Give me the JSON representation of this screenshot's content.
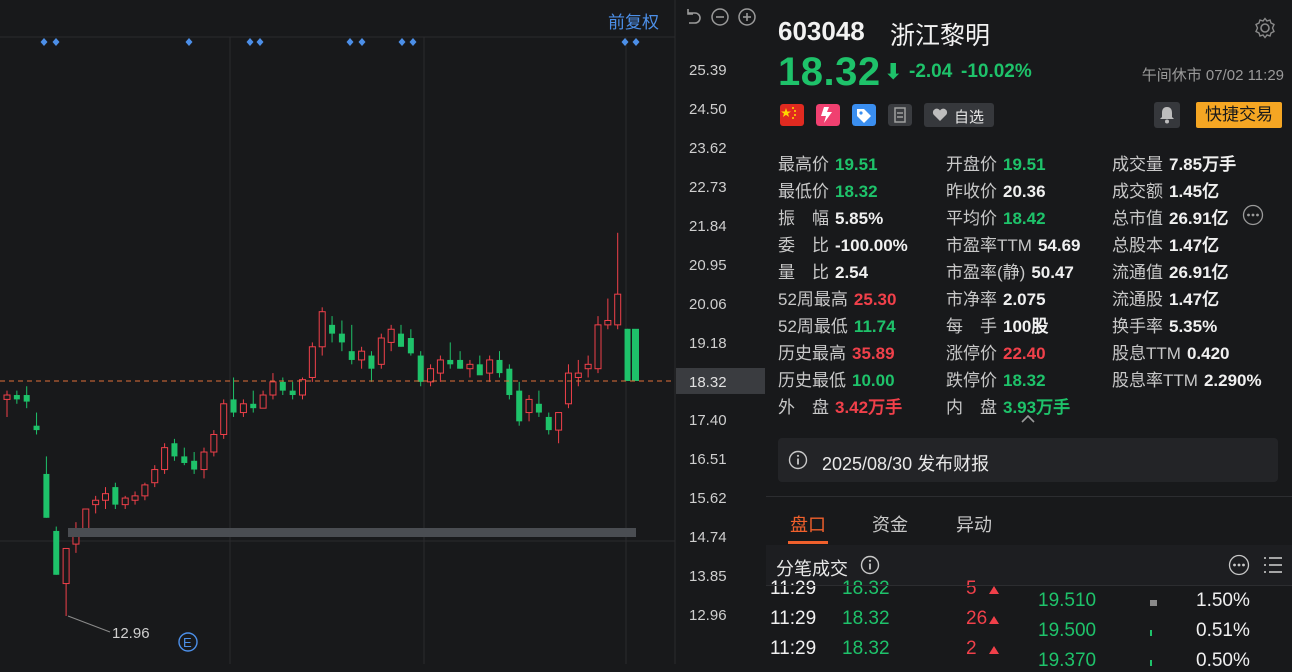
{
  "chart": {
    "restore_label": "前复权",
    "y_ticks": [
      "25.39",
      "24.50",
      "23.62",
      "22.73",
      "21.84",
      "20.95",
      "20.06",
      "19.18",
      "18.32",
      "17.40",
      "16.51",
      "15.62",
      "14.74",
      "13.85",
      "12.96"
    ],
    "current_price_tag": "18.32",
    "low_marker_label": "12.96",
    "event_marker": "E",
    "colors": {
      "up": "#f0404a",
      "down": "#1ec26a",
      "dash": "#e07038",
      "marker": "#4c8fe8"
    }
  },
  "stock": {
    "code": "603048",
    "name": "浙江黎明",
    "price": "18.32",
    "arrow": "⬇",
    "change": "-2.04",
    "change_pct": "-10.02%",
    "status": "午间休市 07/02 11:29",
    "watch_label": "自选",
    "quick_trade_label": "快捷交易"
  },
  "stats": {
    "col1": [
      {
        "label": "最高价",
        "value": "19.51",
        "color": "g"
      },
      {
        "label": "最低价",
        "value": "18.32",
        "color": "g"
      },
      {
        "label": "振　幅",
        "value": "5.85%",
        "color": "w"
      },
      {
        "label": "委　比",
        "value": "-100.00%",
        "color": "w"
      },
      {
        "label": "量　比",
        "value": "2.54",
        "color": "w"
      },
      {
        "label": "52周最高",
        "value": "25.30",
        "color": "r"
      },
      {
        "label": "52周最低",
        "value": "11.74",
        "color": "g"
      },
      {
        "label": "历史最高",
        "value": "35.89",
        "color": "r"
      },
      {
        "label": "历史最低",
        "value": "10.00",
        "color": "g"
      },
      {
        "label": "外　盘",
        "value": "3.42万手",
        "color": "r"
      }
    ],
    "col2": [
      {
        "label": "开盘价",
        "value": "19.51",
        "color": "g"
      },
      {
        "label": "昨收价",
        "value": "20.36",
        "color": "w"
      },
      {
        "label": "平均价",
        "value": "18.42",
        "color": "g"
      },
      {
        "label": "市盈率TTM",
        "value": "54.69",
        "color": "w"
      },
      {
        "label": "市盈率(静)",
        "value": "50.47",
        "color": "w"
      },
      {
        "label": "市净率",
        "value": "2.075",
        "color": "w"
      },
      {
        "label": "每　手",
        "value": "100股",
        "color": "w"
      },
      {
        "label": "涨停价",
        "value": "22.40",
        "color": "r"
      },
      {
        "label": "跌停价",
        "value": "18.32",
        "color": "g"
      },
      {
        "label": "内　盘",
        "value": "3.93万手",
        "color": "g"
      }
    ],
    "col3": [
      {
        "label": "成交量",
        "value": "7.85万手",
        "color": "w"
      },
      {
        "label": "成交额",
        "value": "1.45亿",
        "color": "w"
      },
      {
        "label": "总市值",
        "value": "26.91亿",
        "color": "w"
      },
      {
        "label": "总股本",
        "value": "1.47亿",
        "color": "w"
      },
      {
        "label": "流通值",
        "value": "26.91亿",
        "color": "w"
      },
      {
        "label": "流通股",
        "value": "1.47亿",
        "color": "w"
      },
      {
        "label": "换手率",
        "value": "5.35%",
        "color": "w"
      },
      {
        "label": "股息TTM",
        "value": "0.420",
        "color": "w"
      },
      {
        "label": "股息率TTM",
        "value": "2.290%",
        "color": "w"
      }
    ]
  },
  "notice": {
    "text": "2025/08/30 发布财报"
  },
  "tabs": [
    "盘口",
    "资金",
    "异动"
  ],
  "ticks_section": {
    "title": "分笔成交",
    "rows": [
      {
        "time": "11:29",
        "price": "18.32",
        "vol": "5"
      },
      {
        "time": "11:29",
        "price": "18.32",
        "vol": "26"
      },
      {
        "time": "11:29",
        "price": "18.32",
        "vol": "2"
      }
    ],
    "dist": [
      {
        "price": "19.510",
        "pct": "1.50%",
        "bar": 0.06
      },
      {
        "price": "19.500",
        "pct": "0.51%",
        "bar": 0.02
      },
      {
        "price": "19.370",
        "pct": "0.50%",
        "bar": 0.02
      }
    ]
  }
}
